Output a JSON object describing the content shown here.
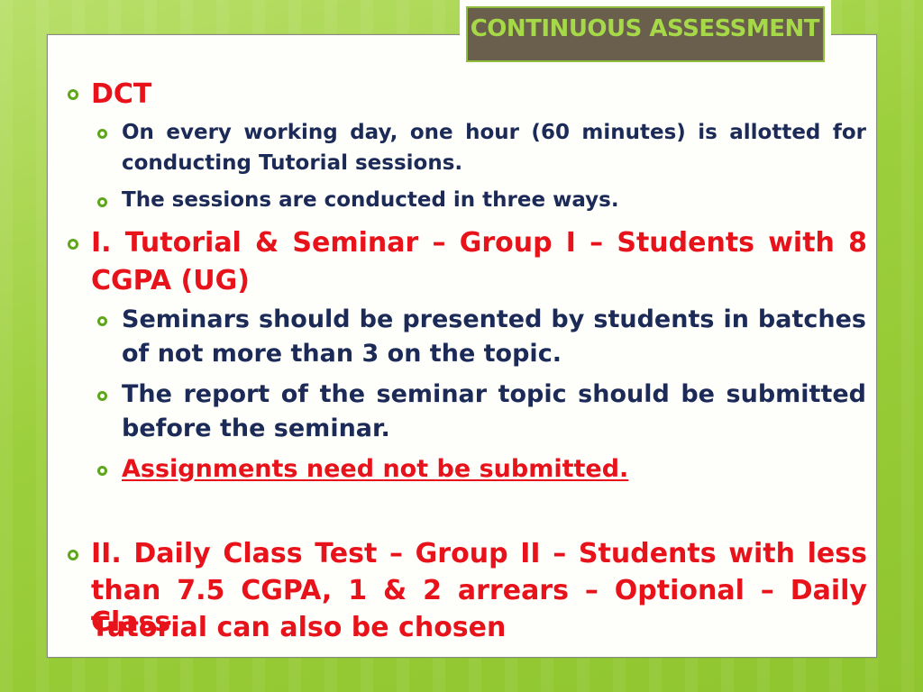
{
  "slide": {
    "title": "CONTINUOUS ASSESSMENT",
    "dct": {
      "label": "DCT",
      "items": [
        {
          "line1": "On every working day, one hour (60 minutes) is allotted for",
          "line2": "conducting Tutorial sessions."
        },
        {
          "line1": "The sessions are conducted in three ways."
        }
      ]
    },
    "group1": {
      "line1": "I. Tutorial & Seminar – Group I – Students with 8",
      "line2": "CGPA (UG)",
      "items": [
        {
          "line1": "Seminars should be presented by students in batches",
          "line2": "of not more than 3 on the topic."
        },
        {
          "line1": "The report of the seminar topic should be submitted",
          "line2": "before the seminar."
        },
        {
          "line1": "Assignments need not be submitted."
        }
      ]
    },
    "group2": {
      "line1": "II. Daily Class Test – Group II – Students with less",
      "line2": "than 7.5 CGPA, 1 & 2 arrears – Optional – Daily Class",
      "line3": "Tutorial can also be chosen"
    }
  },
  "colors": {
    "background": "#9ccf3c",
    "panel": "#fefffb",
    "title_box": "#6a5e4c",
    "title_text": "#a6d948",
    "heading_red": "#e8121b",
    "body_navy": "#1c2a57",
    "bullet_green": "#5ea61a"
  },
  "icons": {
    "bullet": "hollow-circle-bullet"
  }
}
